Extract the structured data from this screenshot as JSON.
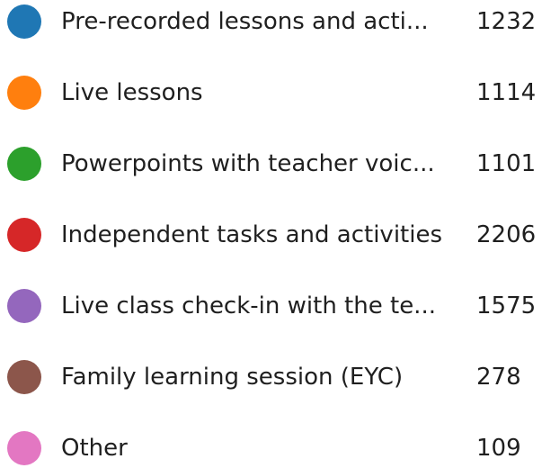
{
  "legend": {
    "items": [
      {
        "label": "Pre-recorded lessons and acti...",
        "count": "1232",
        "color": "#1f77b4"
      },
      {
        "label": "Live lessons",
        "count": "1114",
        "color": "#ff7f0e"
      },
      {
        "label": "Powerpoints with teacher voic...",
        "count": "1101",
        "color": "#2ca02c"
      },
      {
        "label": "Independent tasks and activities",
        "count": "2206",
        "color": "#d62728"
      },
      {
        "label": "Live class check-in with the te...",
        "count": "1575",
        "color": "#9467bd"
      },
      {
        "label": "Family learning session (EYC)",
        "count": "278",
        "color": "#8c564b"
      },
      {
        "label": "Other",
        "count": "109",
        "color": "#e377c2"
      }
    ]
  }
}
